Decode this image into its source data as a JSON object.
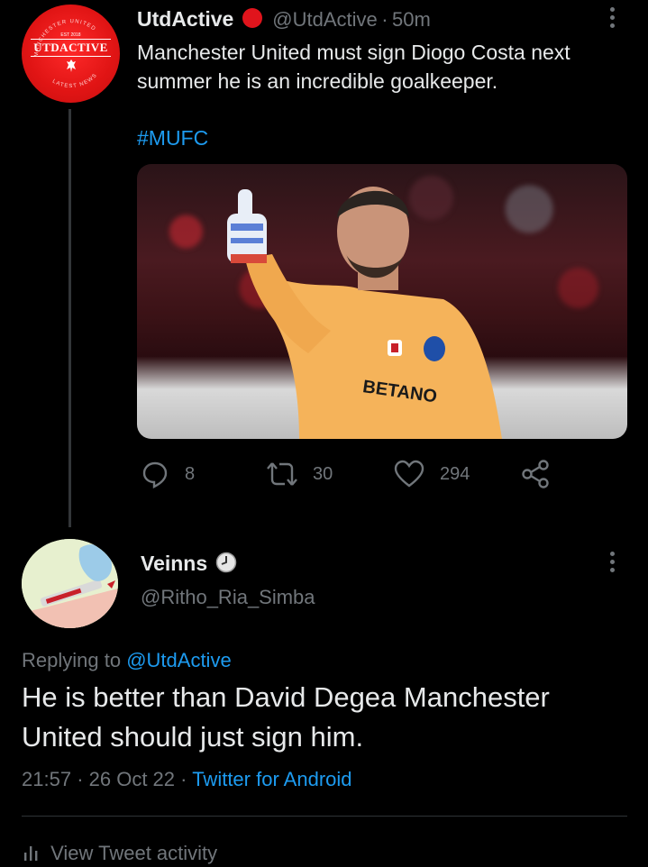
{
  "parent_tweet": {
    "avatar_text": {
      "top_ring": "MANCHESTER UNITED",
      "est": "EST 2018",
      "brand": "UTDACTIVE",
      "bottom_ring": "LATEST NEWS"
    },
    "display_name": "UtdActive",
    "badge_color": "#e0141c",
    "handle": "@UtdActive",
    "separator": "·",
    "time": "50m",
    "text_line1": "Manchester United must sign Diogo Costa next",
    "text_line2": "summer he is an incredible goalkeeper.",
    "hashtag": "#MUFC",
    "media": {
      "shirt_sponsor": "BETANO",
      "kit_color": "#f5b35a"
    },
    "actions": {
      "replies": "8",
      "retweets": "30",
      "likes": "294"
    }
  },
  "reply_tweet": {
    "display_name": "Veinns",
    "handle": "@Ritho_Ria_Simba",
    "replying_prefix": "Replying to",
    "replying_mention": "@UtdActive",
    "text_line1": "He is better than David Degea Manchester",
    "text_line2": "United should just sign him.",
    "time": "21:57",
    "dot1": "·",
    "date": "26 Oct 22",
    "dot2": "·",
    "source": "Twitter for Android",
    "activity_label": "View Tweet activity"
  },
  "colors": {
    "background": "#000000",
    "text": "#e7e9ea",
    "muted": "#71767b",
    "link": "#1d9bf0"
  }
}
